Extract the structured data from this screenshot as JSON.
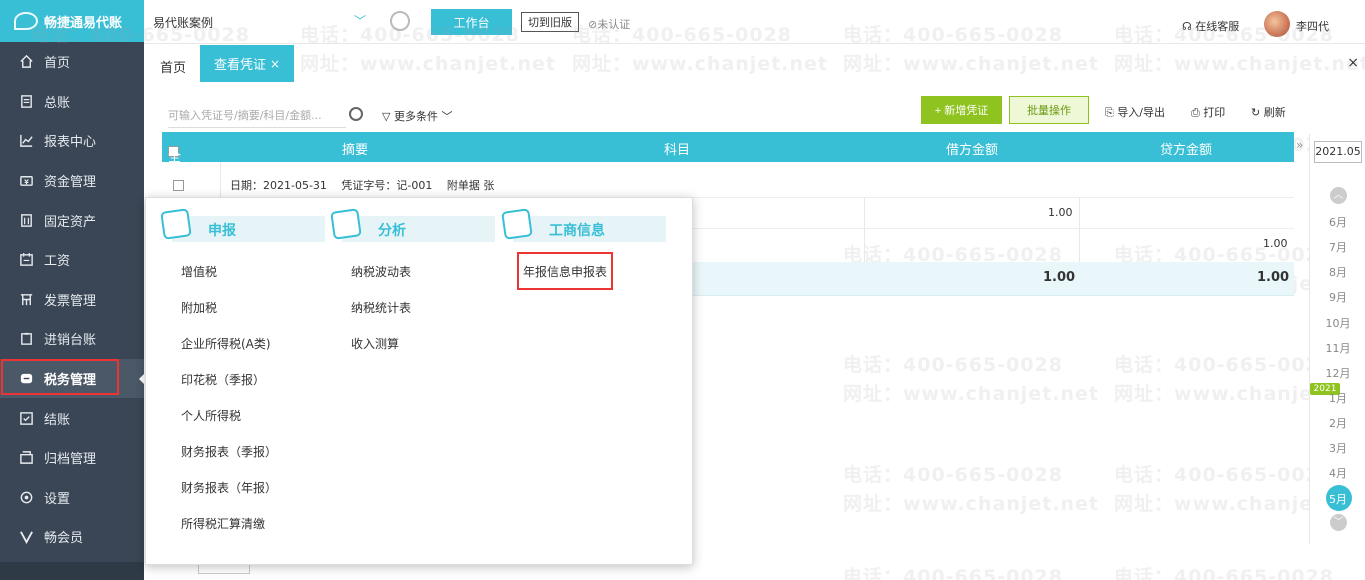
{
  "app": {
    "logo_text": "畅捷通易代账"
  },
  "sidebar": {
    "items": [
      {
        "key": "home",
        "label": "首页",
        "icon": "home-icon"
      },
      {
        "key": "ledger",
        "label": "总账",
        "icon": "ledger-icon"
      },
      {
        "key": "reports",
        "label": "报表中心",
        "icon": "chart-icon"
      },
      {
        "key": "funds",
        "label": "资金管理",
        "icon": "money-icon"
      },
      {
        "key": "assets",
        "label": "固定资产",
        "icon": "building-icon"
      },
      {
        "key": "salary",
        "label": "工资",
        "icon": "calendar-icon"
      },
      {
        "key": "invoice",
        "label": "发票管理",
        "icon": "invoice-icon"
      },
      {
        "key": "inventory",
        "label": "进销台账",
        "icon": "clipboard-icon"
      },
      {
        "key": "tax",
        "label": "税务管理",
        "icon": "tax-icon"
      },
      {
        "key": "closing",
        "label": "结账",
        "icon": "checklist-icon"
      },
      {
        "key": "archive",
        "label": "归档管理",
        "icon": "archive-icon"
      },
      {
        "key": "settings",
        "label": "设置",
        "icon": "gear-icon"
      },
      {
        "key": "member",
        "label": "畅会员",
        "icon": "v-icon"
      }
    ]
  },
  "topbar": {
    "account": "易代账案例",
    "workbench": "工作台",
    "switch_old": "切到旧版",
    "auth_status": "未认证",
    "service": "在线客服",
    "username": "李四代"
  },
  "tabs": {
    "home": "首页",
    "active": "查看凭证",
    "close": "×",
    "close_all": "×"
  },
  "toolbar": {
    "search_placeholder": "可输入凭证号/摘要/科目/金额...",
    "more_conditions": "更多条件",
    "new_voucher": "+ 新增凭证",
    "batch_ops": "批量操作",
    "import_export": "导入/导出",
    "print": "打印",
    "refresh": "刷新"
  },
  "table": {
    "headers": {
      "select_all": "全选",
      "summary": "摘要",
      "subject": "科目",
      "debit": "借方金额",
      "credit": "贷方金额"
    },
    "voucher_info": "日期：2021-05-31　 凭证字号：记-001　 附单据 张",
    "row1_debit": "1.00",
    "row2_credit": "1.00",
    "total_debit": "1.00",
    "total_credit": "1.00"
  },
  "date_strip": {
    "year": "2021.05",
    "year_badge": "2021",
    "months": [
      "6月",
      "7月",
      "8月",
      "9月",
      "10月",
      "11月",
      "12月",
      "1月",
      "2月",
      "3月",
      "4月",
      "5月"
    ]
  },
  "watermark": {
    "phone": "电话：400-665-0028",
    "site": "网址：www.chanjet.net"
  },
  "menu": {
    "columns": [
      {
        "title": "申报",
        "icon": "declare-icon",
        "items": [
          "增值税",
          "附加税",
          "企业所得税(A类)",
          "印花税（季报）",
          "个人所得税",
          "财务报表（季报）",
          "财务报表（年报）",
          "所得税汇算清缴"
        ]
      },
      {
        "title": "分析",
        "icon": "analysis-icon",
        "items": [
          "纳税波动表",
          "纳税统计表",
          "收入测算"
        ]
      },
      {
        "title": "工商信息",
        "icon": "business-icon",
        "items": [
          "年报信息申报表"
        ]
      }
    ]
  },
  "colors": {
    "accent": "#38bfd6",
    "sidebar": "#3a4655",
    "green": "#8fc31f",
    "highlight": "#e33333"
  }
}
